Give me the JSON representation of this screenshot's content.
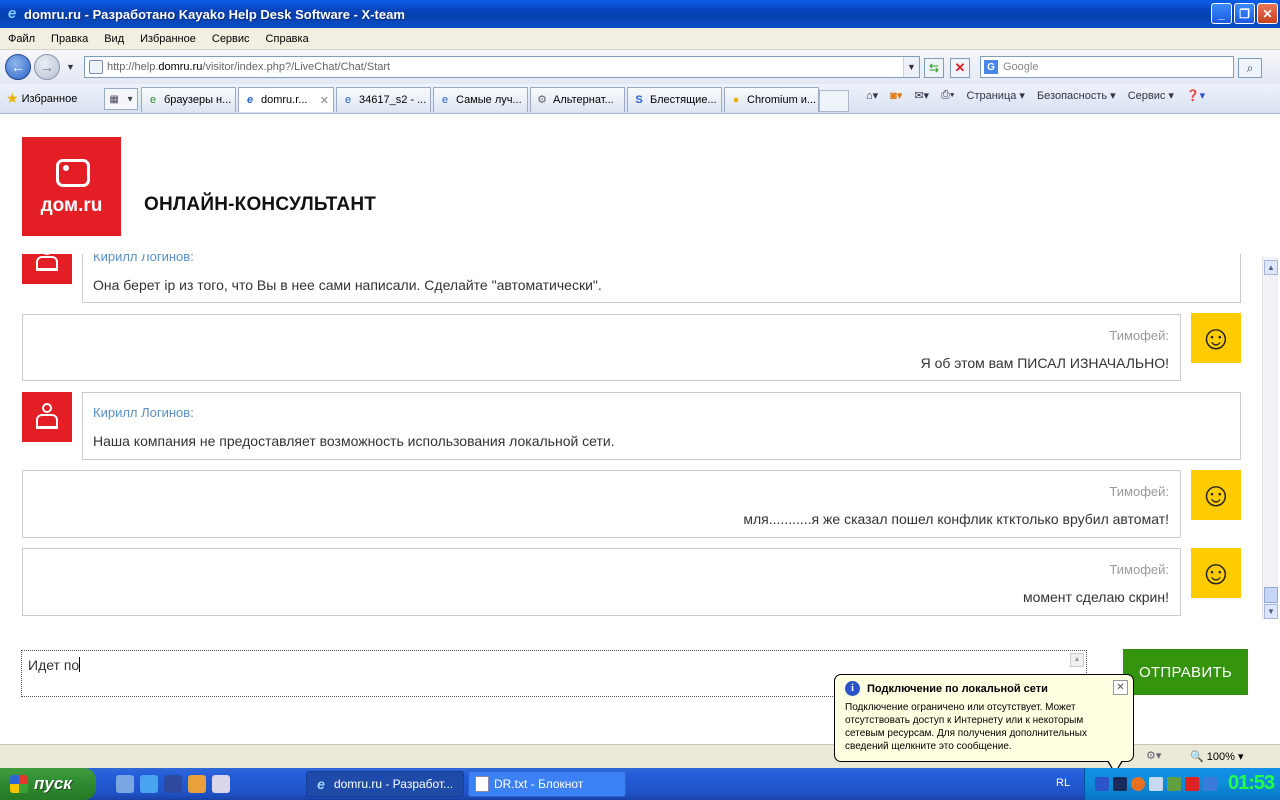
{
  "window": {
    "title": "domru.ru - Разработано Kayako Help Desk Software - X-team"
  },
  "menu": [
    "Файл",
    "Правка",
    "Вид",
    "Избранное",
    "Сервис",
    "Справка"
  ],
  "address": {
    "prefix": "http://help.",
    "domain": "domru.ru",
    "path": "/visitor/index.php?/LiveChat/Chat/Start"
  },
  "search": {
    "placeholder": "Google"
  },
  "favorites_label": "Избранное",
  "tabs": [
    {
      "label": "браузеры н...",
      "active": false
    },
    {
      "label": "domru.r...",
      "active": true
    },
    {
      "label": "34617_s2 - ...",
      "active": false
    },
    {
      "label": "Самые луч...",
      "active": false
    },
    {
      "label": "Альтернат...",
      "active": false
    },
    {
      "label": "Блестящие...",
      "active": false
    },
    {
      "label": "Chromium и...",
      "active": false
    }
  ],
  "commandbar": {
    "page": "Страница",
    "safety": "Безопасность",
    "tools": "Сервис"
  },
  "page": {
    "logo_text": "дом.ru",
    "header_title": "ОНЛАЙН-КОНСУЛЬТАНТ"
  },
  "messages": [
    {
      "from": "agent",
      "name": "Кирилл Логинов:",
      "text": "Она берет ip из того, что Вы в нее сами написали. Сделайте \"автоматически\"."
    },
    {
      "from": "user",
      "name": "Тимофей:",
      "text": "Я об этом вам ПИСАЛ ИЗНАЧАЛЬНО!"
    },
    {
      "from": "agent",
      "name": "Кирилл Логинов:",
      "text": "Наша компания не предоставляет возможность использования локальной сети."
    },
    {
      "from": "user",
      "name": "Тимофей:",
      "text": "мля...........я же сказал пошел конфлик ктктолько врубил автомат!"
    },
    {
      "from": "user",
      "name": "Тимофей:",
      "text": "момент сделаю скрин!"
    }
  ],
  "composer": {
    "value": "Идет по",
    "send_label": "ОТПРАВИТЬ"
  },
  "statusbar": {
    "zoom": "100%"
  },
  "balloon": {
    "title": "Подключение по локальной сети",
    "text": "Подключение ограничено или отсутствует. Может отсутствовать доступ к Интернету или к некоторым сетевым ресурсам. Для получения дополнительных сведений щелкните это сообщение."
  },
  "taskbar": {
    "start_label": "пуск",
    "windows": [
      {
        "label": "domru.ru - Разработ...",
        "active": true
      },
      {
        "label": "DR.txt - Блокнот",
        "active": false
      }
    ],
    "language": "RL",
    "clock": "01:53"
  }
}
